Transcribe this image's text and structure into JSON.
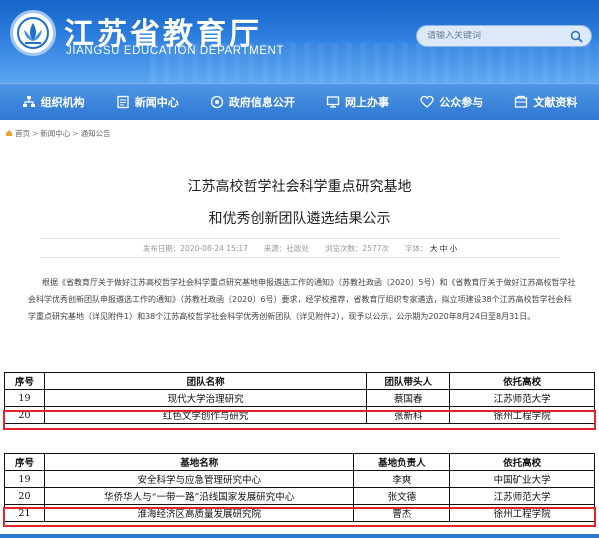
{
  "header": {
    "title": "江苏省教育厅",
    "subtitle": "JIANGSU EDUCATION DEPARTMENT",
    "search_placeholder": "请输入关键词",
    "search_icon": "search-icon",
    "logo_icon": "lotus-logo-icon"
  },
  "nav": {
    "items": [
      {
        "label": "组织机构",
        "icon": "org-icon"
      },
      {
        "label": "新闻中心",
        "icon": "news-icon"
      },
      {
        "label": "政府信息公开",
        "icon": "info-icon"
      },
      {
        "label": "网上办事",
        "icon": "monitor-icon"
      },
      {
        "label": "公众参与",
        "icon": "heart-icon"
      },
      {
        "label": "文献资料",
        "icon": "docs-icon"
      }
    ]
  },
  "breadcrumb": {
    "items": [
      "首页",
      "新闻中心",
      "通知公告"
    ]
  },
  "article": {
    "title_line1": "江苏高校哲学社会科学重点研究基地",
    "title_line2": "和优秀创新团队遴选结果公示",
    "meta": {
      "date": "发布日期：2020-08-24 15:17",
      "source": "来源：社政处",
      "views": "浏览次数：2577次",
      "font_label": "字体：",
      "font_large": "大",
      "font_medium": "中",
      "font_small": "小"
    },
    "body": "根据《省教育厅关于做好江苏高校哲学社会科学重点研究基地申报遴选工作的通知》（苏教社政函〔2020〕5号）和《省教育厅关于做好江苏高校哲学社会科学优秀创新团队申报遴选工作的通知》（苏教社政函〔2020〕6号）要求，经学校推荐，省教育厅组织专家遴选，拟立项建设38个江苏高校哲学社会科学重点研究基地（详见附件1）和38个江苏高校哲学社会科学优秀创新团队（详见附件2），现予以公示，公示期为2020年8月24日至8月31日。"
  },
  "table_teams": {
    "headers": [
      "序号",
      "团队名称",
      "团队带头人",
      "依托高校"
    ],
    "rows": [
      [
        "19",
        "现代大学治理研究",
        "蔡国春",
        "江苏师范大学"
      ],
      [
        "20",
        "红色文学创作与研究",
        "张新科",
        "徐州工程学院"
      ]
    ]
  },
  "table_bases": {
    "headers": [
      "序号",
      "基地名称",
      "基地负责人",
      "依托高校"
    ],
    "rows": [
      [
        "19",
        "安全科学与应急管理研究中心",
        "李爽",
        "中国矿业大学"
      ],
      [
        "20",
        "华侨华人与“一带一路”沿线国家发展研究中心",
        "张文德",
        "江苏师范大学"
      ],
      [
        "21",
        "淮海经济区高质量发展研究院",
        "曹杰",
        "徐州工程学院"
      ]
    ]
  },
  "colors": {
    "header_blue": "#2e7fe0",
    "nav_blue": "#2f78d2",
    "highlight_red": "#e0252b"
  }
}
